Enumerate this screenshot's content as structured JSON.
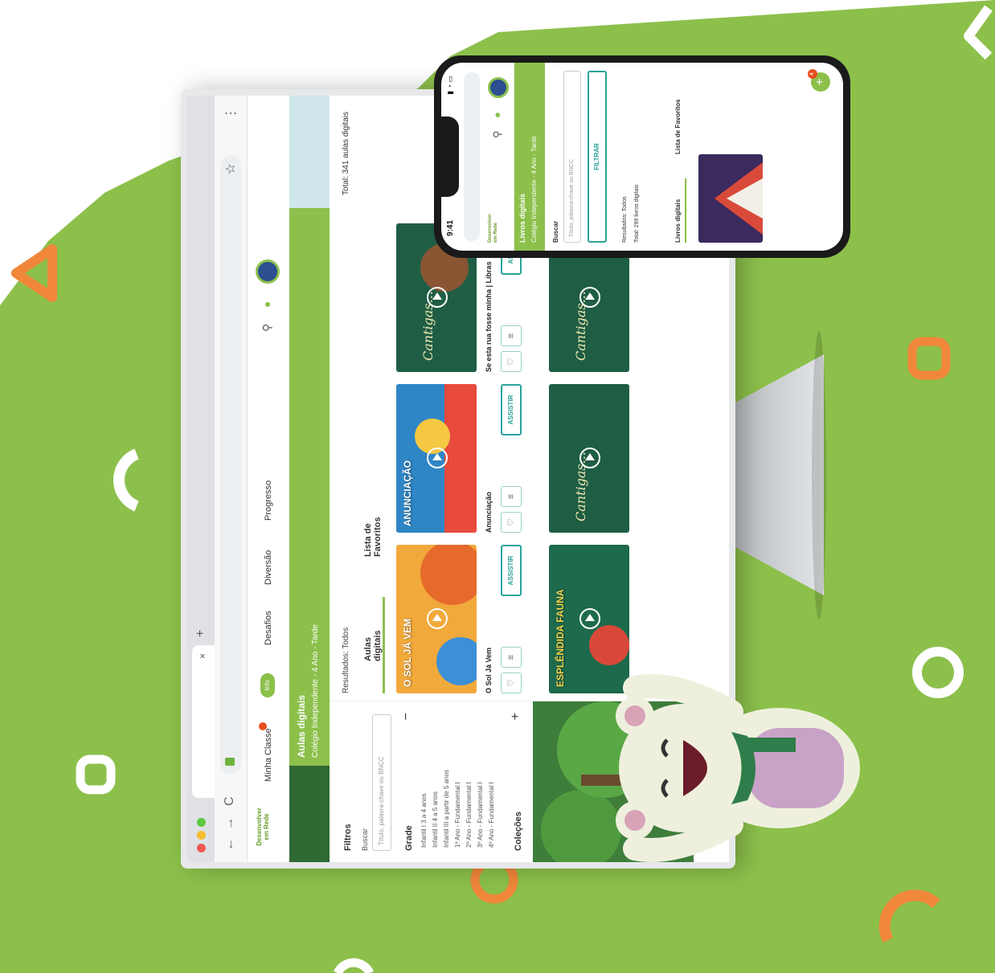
{
  "colors": {
    "brand_green": "#8cc04b",
    "accent_teal": "#2aa39a",
    "accent_orange": "#f0873a",
    "badge_red": "#e94e1b"
  },
  "browser": {
    "tab_close": "×",
    "new_tab": "+",
    "nav": {
      "back": "←",
      "forward": "→",
      "reload": "C"
    }
  },
  "site": {
    "logo": "Desenvolver em Rede",
    "nav": [
      "Minha Classe",
      "Info",
      "Desafios",
      "Diversão",
      "Progresso"
    ],
    "minha_classe_badge": "",
    "banner": {
      "title": "Aulas digitais",
      "subtitle": "Colégio Independente - 4 Ano - Tarde"
    }
  },
  "sidebar": {
    "filters_title": "Filtros",
    "search_label": "Buscar",
    "search_placeholder": "Título, palavra-chave ou BNCC",
    "grade_title": "Grade",
    "grade_toggle": "−",
    "grades": [
      "Infantil I 3 a 4 anos",
      "Infantil II 4 a 5 anos",
      "Infantil III a partir de 5 anos",
      "1º Ano - Fundamental I",
      "2º Ano - Fundamental I",
      "3º Ano - Fundamental I",
      "4º Ano - Fundamental I"
    ],
    "collections_title": "Coleções",
    "collections_toggle": "+"
  },
  "main": {
    "results": "Resultados: Todos",
    "total": "Total: 341 aulas digitais",
    "tabs": [
      "Aulas digitais",
      "Lista de Favoritos"
    ],
    "cards": [
      {
        "title": "O Sol Já Vem",
        "thumb_text": "O SOL JÁ VEM",
        "action": "ASSISTIR"
      },
      {
        "title": "Anunciação",
        "thumb_text": "ANUNCIAÇÃO",
        "action": "ASSISTIR"
      },
      {
        "title": "Se esta rua fosse minha | Libras",
        "thumb_text": "Cantigas...",
        "action": "ASSISTIR"
      }
    ],
    "cards_row2": [
      {
        "thumb_text": "ESPLÊNDIDA FAUNA"
      },
      {
        "thumb_text": "Cantigas..."
      },
      {
        "thumb_text": "Cantigas..."
      }
    ]
  },
  "phone": {
    "time": "9:41",
    "logo": "Desenvolver em Rede",
    "banner": {
      "title": "Livros digitais",
      "subtitle": "Colégio Independente - 4 Ano - Tarde"
    },
    "search_label": "Buscar",
    "search_placeholder": "Título, palavra-chave ou BNCC",
    "filter_button": "FILTRAR",
    "results": "Resultados: Todos",
    "total": "Total: 299 livros digitais",
    "tabs": [
      "Livros digitais",
      "Lista de Favoritos"
    ],
    "fab_badge": "4",
    "fab_icon": "+"
  }
}
